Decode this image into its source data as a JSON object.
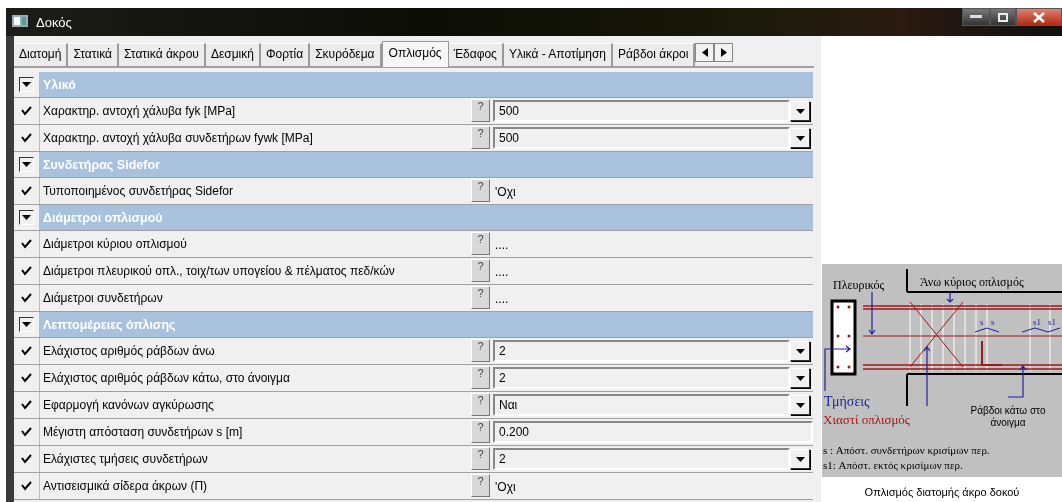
{
  "window": {
    "title": "Δοκός"
  },
  "tabs": [
    {
      "label": "Διατομή",
      "selected": false
    },
    {
      "label": "Στατικά",
      "selected": false
    },
    {
      "label": "Στατικά άκρου",
      "selected": false
    },
    {
      "label": "Δεσμική",
      "selected": false
    },
    {
      "label": "Φορτία",
      "selected": false
    },
    {
      "label": "Σκυρόδεμα",
      "selected": false
    },
    {
      "label": "Οπλισμός",
      "selected": true
    },
    {
      "label": "Έδαφος",
      "selected": false
    },
    {
      "label": "Υλικά - Αποτίμηση",
      "selected": false
    },
    {
      "label": "Ράβδοι άκροι",
      "selected": false
    }
  ],
  "properties": [
    {
      "kind": "section",
      "label": "Υλικό",
      "expanded": true
    },
    {
      "kind": "combo",
      "label": "Χαρακτηρ. αντοχή χάλυβα fyk [MPa]",
      "checked": true,
      "help": "?",
      "value": "500"
    },
    {
      "kind": "combo",
      "label": "Χαρακτηρ. αντοχή χάλυβα συνδετήρων fywk [MPa]",
      "checked": true,
      "help": "?",
      "value": "500"
    },
    {
      "kind": "section",
      "label": "Συνδετήρας Sidefor",
      "expanded": true
    },
    {
      "kind": "static",
      "label": "Τυποποιημένος συνδετήρας Sidefor",
      "checked": true,
      "help": "?",
      "value": "'Οχι"
    },
    {
      "kind": "section",
      "label": "Διάμετροι οπλισμού",
      "expanded": true
    },
    {
      "kind": "static",
      "label": "Διάμετροι κύριου οπλισμού",
      "checked": true,
      "help": "?",
      "value": "...."
    },
    {
      "kind": "static",
      "label": "Διάμετροι πλευρικού οπλ., τοιχ/των υπογείου & πέλματος πεδ/κών",
      "checked": true,
      "help": "?",
      "value": "...."
    },
    {
      "kind": "static",
      "label": "Διάμετροι συνδετήρων",
      "checked": true,
      "help": "?",
      "value": "...."
    },
    {
      "kind": "section",
      "label": "Λεπτομέρειες όπλισης",
      "expanded": true
    },
    {
      "kind": "combo",
      "label": "Ελάχιστος αριθμός ράβδων άνω",
      "checked": true,
      "help": "?",
      "value": "2"
    },
    {
      "kind": "combo",
      "label": "Ελάχιστος αριθμός ράβδων κάτω, στο άνοιγμα",
      "checked": true,
      "help": "?",
      "value": "2"
    },
    {
      "kind": "combo",
      "label": "Εφαρμογή κανόνων αγκύρωσης",
      "checked": true,
      "help": "?",
      "value": "Ναι"
    },
    {
      "kind": "input",
      "label": "Μέγιστη απόσταση συνδετήρων s [m]",
      "checked": true,
      "help": "?",
      "value": "0.200"
    },
    {
      "kind": "combo",
      "label": "Ελάχιστες τμήσεις συνδετήρων",
      "checked": true,
      "help": "?",
      "value": "2"
    },
    {
      "kind": "static",
      "label": "Αντισεισμικά σίδερα άκρων (Π)",
      "checked": true,
      "help": "?",
      "value": "'Οχι"
    }
  ],
  "diagram": {
    "labels": [
      "Πλευρικός",
      "Άνω κύριος οπλισμός",
      "s",
      "s",
      "s1",
      "s1",
      "Τμήσεις",
      "Χιαστί οπλισμός",
      "Ράβδοι κάτω στο",
      "άνοιγμα"
    ],
    "legend": [
      "s : Απόστ. συνδετήρων κρισίμων περ.",
      "s1: Απόστ. εκτός κρισίμων περ."
    ],
    "caption": "Οπλισμός διατομής άκρο δοκού"
  }
}
